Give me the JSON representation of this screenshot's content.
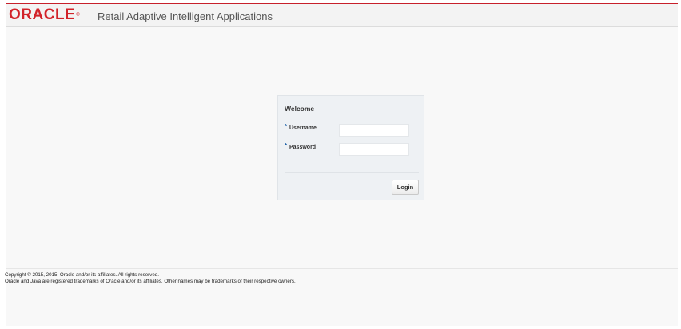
{
  "header": {
    "brand": "ORACLE",
    "brand_mark": "®",
    "app_title": "Retail Adaptive Intelligent Applications"
  },
  "login": {
    "title": "Welcome",
    "required_marker": "*",
    "username_label": "Username",
    "username_value": "",
    "password_label": "Password",
    "password_value": "",
    "button_label": "Login"
  },
  "footer": {
    "copyright": "Copyright © 2015, 2015, Oracle and/or its affiliates. All rights reserved.",
    "trademark": "Oracle and Java are registered trademarks of Oracle and/or its affiliates. Other names may be trademarks of their respective owners."
  },
  "colors": {
    "brand_red": "#d2232a",
    "required_blue": "#1a5fa8",
    "panel_bg": "#eef1f4"
  }
}
